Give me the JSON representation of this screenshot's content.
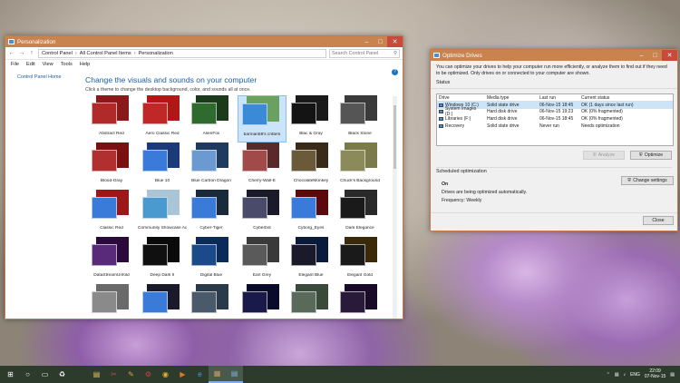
{
  "personalization": {
    "title": "Personalization",
    "breadcrumb": [
      "Control Panel",
      "All Control Panel Items",
      "Personalization"
    ],
    "search_placeholder": "Search Control Panel",
    "menu": [
      "File",
      "Edit",
      "View",
      "Tools",
      "Help"
    ],
    "left_link": "Control Panel Home",
    "heading": "Change the visuals and sounds on your computer",
    "subheading": "Click a theme to change the desktop background, color, and sounds all at once.",
    "themes": [
      {
        "label": "Abstract Red",
        "back": "#8a1a1a",
        "front": "#b02a2a"
      },
      {
        "label": "Aero Classic Red",
        "back": "#b01818",
        "front": "#c02828"
      },
      {
        "label": "AlienFox",
        "back": "#1a3a1a",
        "front": "#2f6a2f"
      },
      {
        "label": "barman58's critters",
        "back": "#6aa060",
        "front": "#3a8ad8"
      },
      {
        "label": "Blac & Gray",
        "back": "#1a1a1a",
        "front": "#141414"
      },
      {
        "label": "Black Stone",
        "back": "#3a3a3a",
        "front": "#555555"
      },
      {
        "label": "Blood-Gray",
        "back": "#7a1010",
        "front": "#b03030"
      },
      {
        "label": "Blue 10",
        "back": "#1a3a7a",
        "front": "#3a7ad8"
      },
      {
        "label": "Blue Carbon Dragon",
        "back": "#1e3a5e",
        "front": "#6a9ad0"
      },
      {
        "label": "Cherry-Wall-E",
        "back": "#5a2a2a",
        "front": "#a04a4a"
      },
      {
        "label": "ChocolateMonkey",
        "back": "#3a2a1a",
        "front": "#6a5a3a"
      },
      {
        "label": "Chuck's Background",
        "back": "#7a7a4a",
        "front": "#8a8a5a"
      },
      {
        "label": "Classic Red",
        "back": "#9a1818",
        "front": "#3a7ad8"
      },
      {
        "label": "Community Showcase Aqua 4",
        "back": "#aac4d8",
        "front": "#4a9ad0"
      },
      {
        "label": "Cyber-Tiger",
        "back": "#1a2a3a",
        "front": "#3a7ad8"
      },
      {
        "label": "Cyberbot",
        "back": "#1a1a2a",
        "front": "#4a4a6a"
      },
      {
        "label": "Cyborg_Eyes",
        "back": "#5a0a0a",
        "front": "#3a7ad8"
      },
      {
        "label": "Dark Elegance",
        "back": "#2a2a2a",
        "front": "#1a1a1a"
      },
      {
        "label": "DataStreamUnfold",
        "back": "#2a0a3a",
        "front": "#5a2a7a"
      },
      {
        "label": "Deep Dark II",
        "back": "#0a0a0a",
        "front": "#101010"
      },
      {
        "label": "Digital Blue",
        "back": "#0a2a5a",
        "front": "#1a4a8a"
      },
      {
        "label": "Earl Grey",
        "back": "#3a3a3a",
        "front": "#5a5a5a"
      },
      {
        "label": "Elegant Blue",
        "back": "#0a1a3a",
        "front": "#1a1a2a"
      },
      {
        "label": "Elegant Gold",
        "back": "#3a2a0a",
        "front": "#1a1a1a"
      },
      {
        "label": "",
        "back": "#6a6a6a",
        "front": "#8a8a8a"
      },
      {
        "label": "",
        "back": "#1a1a2a",
        "front": "#3a7ad8"
      },
      {
        "label": "",
        "back": "#2a3a4a",
        "front": "#4a5a6a"
      },
      {
        "label": "",
        "back": "#0a0a2a",
        "front": "#1a1a4a"
      },
      {
        "label": "",
        "back": "#3a4a3a",
        "front": "#5a6a5a"
      },
      {
        "label": "",
        "back": "#1a0a2a",
        "front": "#2a1a3a"
      }
    ]
  },
  "optimize": {
    "title": "Optimize Drives",
    "description": "You can optimize your drives to help your computer run more efficiently, or analyze them to find out if they need to be optimized. Only drives on or connected to your computer are shown.",
    "status_label": "Status",
    "columns": [
      "Drive",
      "Media type",
      "Last run",
      "Current status"
    ],
    "drives": [
      {
        "drive": "Windows 10 (C:)",
        "media": "Solid state drive",
        "last": "06-Nov-15 18:45",
        "status": "OK (1 days since last run)"
      },
      {
        "drive": "System Images (D:)",
        "media": "Hard disk drive",
        "last": "06-Nov-15 19:23",
        "status": "OK (0% fragmented)"
      },
      {
        "drive": "Libraries (F:)",
        "media": "Hard disk drive",
        "last": "06-Nov-15 18:45",
        "status": "OK (0% fragmented)"
      },
      {
        "drive": "Recovery",
        "media": "Solid state drive",
        "last": "Never run",
        "status": "Needs optimization"
      }
    ],
    "analyze_label": "Analyze",
    "optimize_label": "Optimize",
    "sched_label": "Scheduled optimization",
    "sched_on": "On",
    "sched_text": "Drives are being optimized automatically.",
    "sched_freq": "Frequency: Weekly",
    "change_settings_label": "Change settings",
    "close_label": "Close"
  },
  "taskbar": {
    "time": "22:09",
    "date": "07-Nov-15",
    "lang": "ENG"
  }
}
